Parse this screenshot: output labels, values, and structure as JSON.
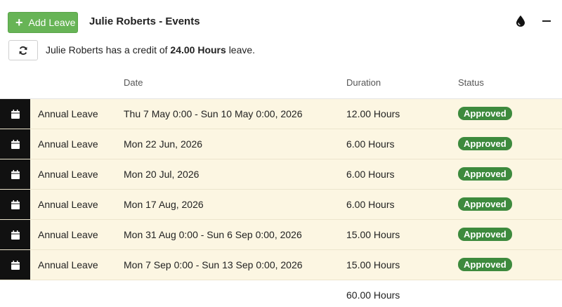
{
  "header": {
    "add_label": "Add Leave",
    "title": "Julie Roberts - Events",
    "icons": [
      "plus-icon",
      "drop-icon",
      "minus-icon"
    ]
  },
  "credit": {
    "prefix": "Julie Roberts has a credit of",
    "amount": "24.00 Hours",
    "suffix": "leave.",
    "refresh_icon": "refresh-icon"
  },
  "table": {
    "columns": [
      "",
      "",
      "Date",
      "Duration",
      "Status"
    ],
    "rows": [
      {
        "type": "Annual Leave",
        "date": "Thu 7 May 0:00 - Sun 10 May 0:00, 2026",
        "duration": "12.00 Hours",
        "status": "Approved"
      },
      {
        "type": "Annual Leave",
        "date": "Mon 22 Jun, 2026",
        "duration": "6.00 Hours",
        "status": "Approved"
      },
      {
        "type": "Annual Leave",
        "date": "Mon 20 Jul, 2026",
        "duration": "6.00 Hours",
        "status": "Approved"
      },
      {
        "type": "Annual Leave",
        "date": "Mon 17 Aug, 2026",
        "duration": "6.00 Hours",
        "status": "Approved"
      },
      {
        "type": "Annual Leave",
        "date": "Mon 31 Aug 0:00 - Sun 6 Sep 0:00, 2026",
        "duration": "15.00 Hours",
        "status": "Approved"
      },
      {
        "type": "Annual Leave",
        "date": "Mon 7 Sep 0:00 - Sun 13 Sep 0:00, 2026",
        "duration": "15.00 Hours",
        "status": "Approved"
      }
    ],
    "total": "60.00 Hours",
    "row_icon": "calendar-icon"
  },
  "colors": {
    "accent_green": "#67b456",
    "status_green": "#3d8a3d",
    "row_bg": "#fcf6e2",
    "icon_cell_bg": "#111111"
  }
}
